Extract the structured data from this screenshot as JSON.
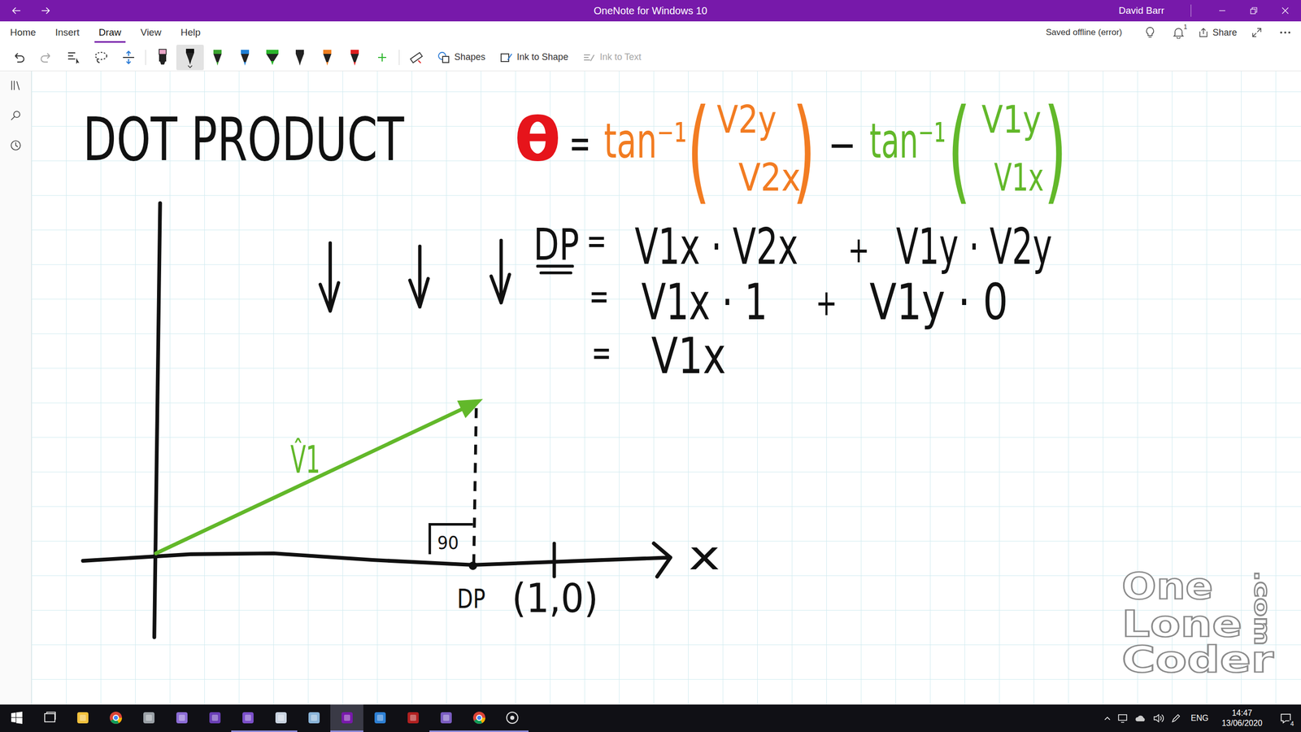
{
  "window": {
    "title": "OneNote for Windows 10",
    "user": "David Barr"
  },
  "menu_tabs": [
    {
      "label": "Home",
      "selected": false
    },
    {
      "label": "Insert",
      "selected": false
    },
    {
      "label": "Draw",
      "selected": true
    },
    {
      "label": "View",
      "selected": false
    },
    {
      "label": "Help",
      "selected": false
    }
  ],
  "ribbon_status": {
    "sync": "Saved offline (error)",
    "notifications": "1",
    "share": "Share"
  },
  "toolbar": {
    "tools": [
      {
        "kind": "undo",
        "disabled": false
      },
      {
        "kind": "redo",
        "disabled": true
      },
      {
        "kind": "type-select",
        "disabled": false
      },
      {
        "kind": "lasso",
        "disabled": false
      },
      {
        "kind": "add-space",
        "disabled": false
      }
    ],
    "pens": [
      {
        "kind": "highlighter",
        "color": "#e9a6c8",
        "selected": false
      },
      {
        "kind": "pen",
        "color": "#111111",
        "selected": true
      },
      {
        "kind": "pen",
        "color": "#3aa32f",
        "selected": false
      },
      {
        "kind": "pen",
        "color": "#1f7fd6",
        "selected": false
      },
      {
        "kind": "marker",
        "color": "#2bb52b",
        "selected": false
      },
      {
        "kind": "pen",
        "color": "#222222",
        "selected": false
      },
      {
        "kind": "pen",
        "color": "#f07f20",
        "selected": false
      },
      {
        "kind": "pen",
        "color": "#e02020",
        "selected": false
      }
    ],
    "actions": [
      {
        "label": "Shapes",
        "kind": "shapes",
        "disabled": false
      },
      {
        "label": "Ink to Shape",
        "kind": "ink-to-shape",
        "disabled": false
      },
      {
        "label": "Ink to Text",
        "kind": "ink-to-text",
        "disabled": true
      }
    ]
  },
  "page": {
    "title": "DOT PRODUCT",
    "angle_formula": {
      "theta": "θ",
      "equals": "=",
      "minus": "−",
      "terms": [
        {
          "func": "tan⁻¹",
          "open": "(",
          "close": ")",
          "numerator": "V2y",
          "denominator": "V2x",
          "color": "#f27c22"
        },
        {
          "func": "tan⁻¹",
          "open": "(",
          "close": ")",
          "numerator": "V1y",
          "denominator": "V1x",
          "color": "#62b82a"
        }
      ]
    },
    "dot_product": {
      "label": "DP",
      "lines": [
        {
          "equals": "=",
          "left": "V1x · V2x",
          "plus": "+",
          "right": "V1y · V2y"
        },
        {
          "equals": "=",
          "left": "V1x · 1",
          "plus": "+",
          "right": "V1y · 0"
        },
        {
          "equals": "=",
          "left": "V1x"
        }
      ]
    },
    "graph": {
      "vector_label": "V̂1",
      "angle_label": "90",
      "point_label": "DP",
      "unit_point_label": "(1,0)",
      "axis_label": "x"
    }
  },
  "watermark": {
    "lines": [
      "One",
      "Lone",
      "Coder"
    ],
    "side": ".com"
  },
  "taskbar": {
    "apps": [
      {
        "kind": "start",
        "running": false,
        "selected": false
      },
      {
        "kind": "task-view",
        "running": false,
        "selected": false
      },
      {
        "kind": "explorer",
        "running": false,
        "selected": false
      },
      {
        "kind": "chrome",
        "running": false,
        "selected": false
      },
      {
        "kind": "utility",
        "running": false,
        "selected": false
      },
      {
        "kind": "visual-studio",
        "running": false,
        "selected": false
      },
      {
        "kind": "visual-studio-preview",
        "running": false,
        "selected": false
      },
      {
        "kind": "visual-studio-old",
        "running": true,
        "selected": false
      },
      {
        "kind": "paint",
        "running": true,
        "selected": false
      },
      {
        "kind": "pencil-tool",
        "running": false,
        "selected": false
      },
      {
        "kind": "onenote",
        "running": true,
        "selected": true
      },
      {
        "kind": "remote",
        "running": false,
        "selected": false
      },
      {
        "kind": "game",
        "running": false,
        "selected": false
      },
      {
        "kind": "chat",
        "running": true,
        "selected": false
      },
      {
        "kind": "chrome",
        "running": true,
        "selected": false
      },
      {
        "kind": "obs",
        "running": true,
        "selected": false
      }
    ],
    "language": "ENG",
    "time": "14:47",
    "date": "13/06/2020",
    "notifications": "4"
  }
}
